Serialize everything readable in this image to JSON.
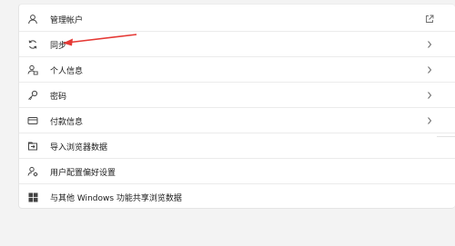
{
  "colors": {
    "panel_bg": "#ffffff",
    "page_bg": "#f3f3f3",
    "text": "#1a1a1a",
    "icon": "#444444",
    "chevron": "#6a6a6a",
    "annotation_arrow": "#e53935"
  },
  "settings": {
    "items": [
      {
        "label": "管理帐户",
        "icon": "person-icon",
        "action": "external-link-icon"
      },
      {
        "label": "同步",
        "icon": "sync-icon",
        "action": "chevron-right-icon"
      },
      {
        "label": "个人信息",
        "icon": "person-card-icon",
        "action": "chevron-right-icon"
      },
      {
        "label": "密码",
        "icon": "key-icon",
        "action": "chevron-right-icon"
      },
      {
        "label": "付款信息",
        "icon": "card-icon",
        "action": "chevron-right-icon"
      },
      {
        "label": "导入浏览器数据",
        "icon": "import-icon",
        "action": ""
      },
      {
        "label": "用户配置偏好设置",
        "icon": "profile-settings-icon",
        "action": ""
      },
      {
        "label": "与其他 Windows 功能共享浏览数据",
        "icon": "windows-logo-icon",
        "action": ""
      }
    ]
  },
  "annotation": {
    "icon": "red-arrow-icon"
  }
}
